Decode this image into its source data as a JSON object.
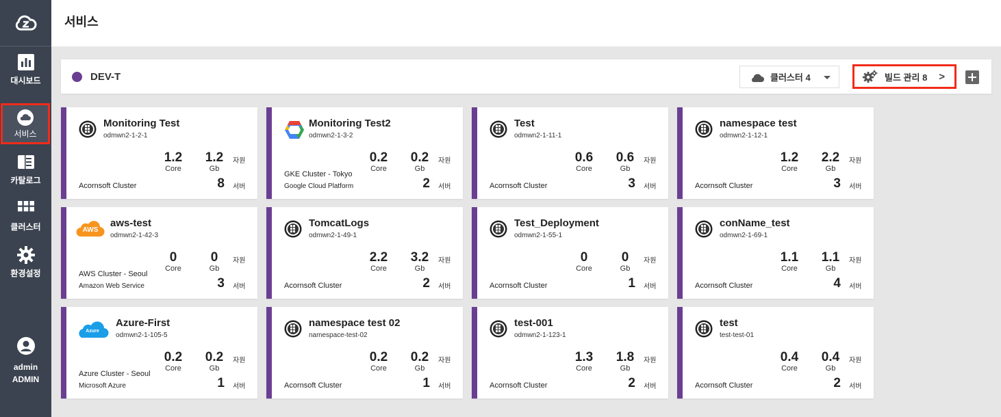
{
  "sidebar": {
    "items": [
      {
        "label": "대시보드",
        "icon": "dashboard-icon"
      },
      {
        "label": "서비스",
        "icon": "cloud-icon",
        "active": true
      },
      {
        "label": "카탈로그",
        "icon": "catalog-icon"
      },
      {
        "label": "클러스터",
        "icon": "grid-icon"
      },
      {
        "label": "환경설정",
        "icon": "gear-icon"
      }
    ],
    "user": {
      "name": "admin",
      "role": "ADMIN"
    }
  },
  "header": {
    "title": "서비스"
  },
  "toolbar": {
    "service_name": "DEV-T",
    "cluster_label": "클러스터 4",
    "build_label": "빌드 관리 8",
    "build_arrow": ">",
    "accent": "#6a3f92",
    "highlight": "#f12b1a"
  },
  "cards": [
    {
      "title": "Monitoring Test",
      "sub": "odmwn2-1-2-1",
      "core": "1.2",
      "core_unit": "Core",
      "gb": "1.2",
      "gb_unit": "Gb",
      "res_label": "자원",
      "servers": "8",
      "srv_label": "서버",
      "line1": "Acornsoft Cluster",
      "line2": "",
      "icon": "kubernetes-icon"
    },
    {
      "title": "Monitoring Test2",
      "sub": "odmwn2-1-3-2",
      "core": "0.2",
      "core_unit": "Core",
      "gb": "0.2",
      "gb_unit": "Gb",
      "res_label": "자원",
      "servers": "2",
      "srv_label": "서버",
      "line1": "GKE Cluster - Tokyo",
      "line2": "Google Cloud Platform",
      "icon": "gcp-icon"
    },
    {
      "title": "Test",
      "sub": "odmwn2-1-11-1",
      "core": "0.6",
      "core_unit": "Core",
      "gb": "0.6",
      "gb_unit": "Gb",
      "res_label": "자원",
      "servers": "3",
      "srv_label": "서버",
      "line1": "Acornsoft Cluster",
      "line2": "",
      "icon": "kubernetes-icon"
    },
    {
      "title": "namespace test",
      "sub": "odmwn2-1-12-1",
      "core": "1.2",
      "core_unit": "Core",
      "gb": "2.2",
      "gb_unit": "Gb",
      "res_label": "자원",
      "servers": "3",
      "srv_label": "서버",
      "line1": "Acornsoft Cluster",
      "line2": "",
      "icon": "kubernetes-icon"
    },
    {
      "title": "aws-test",
      "sub": "odmwn2-1-42-3",
      "core": "0",
      "core_unit": "Core",
      "gb": "0",
      "gb_unit": "Gb",
      "res_label": "자원",
      "servers": "3",
      "srv_label": "서버",
      "line1": "AWS Cluster - Seoul",
      "line2": "Amazon Web Service",
      "icon": "aws-icon",
      "icon_text": "AWS"
    },
    {
      "title": "TomcatLogs",
      "sub": "odmwn2-1-49-1",
      "core": "2.2",
      "core_unit": "Core",
      "gb": "3.2",
      "gb_unit": "Gb",
      "res_label": "자원",
      "servers": "2",
      "srv_label": "서버",
      "line1": "Acornsoft Cluster",
      "line2": "",
      "icon": "kubernetes-icon"
    },
    {
      "title": "Test_Deployment",
      "sub": "odmwn2-1-55-1",
      "core": "0",
      "core_unit": "Core",
      "gb": "0",
      "gb_unit": "Gb",
      "res_label": "자원",
      "servers": "1",
      "srv_label": "서버",
      "line1": "Acornsoft Cluster",
      "line2": "",
      "icon": "kubernetes-icon"
    },
    {
      "title": "conName_test",
      "sub": "odmwn2-1-69-1",
      "core": "1.1",
      "core_unit": "Core",
      "gb": "1.1",
      "gb_unit": "Gb",
      "res_label": "자원",
      "servers": "4",
      "srv_label": "서버",
      "line1": "Acornsoft Cluster",
      "line2": "",
      "icon": "kubernetes-icon"
    },
    {
      "title": "Azure-First",
      "sub": "odmwn2-1-105-5",
      "core": "0.2",
      "core_unit": "Core",
      "gb": "0.2",
      "gb_unit": "Gb",
      "res_label": "자원",
      "servers": "1",
      "srv_label": "서버",
      "line1": "Azure Cluster - Seoul",
      "line2": "Microsoft Azure",
      "icon": "azure-icon",
      "icon_text": "Azure"
    },
    {
      "title": "namespace test 02",
      "sub": "namespace-test-02",
      "core": "0.2",
      "core_unit": "Core",
      "gb": "0.2",
      "gb_unit": "Gb",
      "res_label": "자원",
      "servers": "1",
      "srv_label": "서버",
      "line1": "Acornsoft Cluster",
      "line2": "",
      "icon": "kubernetes-icon"
    },
    {
      "title": "test-001",
      "sub": "odmwn2-1-123-1",
      "core": "1.3",
      "core_unit": "Core",
      "gb": "1.8",
      "gb_unit": "Gb",
      "res_label": "자원",
      "servers": "2",
      "srv_label": "서버",
      "line1": "Acornsoft Cluster",
      "line2": "",
      "icon": "kubernetes-icon"
    },
    {
      "title": "test",
      "sub": "test-test-01",
      "core": "0.4",
      "core_unit": "Core",
      "gb": "0.4",
      "gb_unit": "Gb",
      "res_label": "자원",
      "servers": "2",
      "srv_label": "서버",
      "line1": "Acornsoft Cluster",
      "line2": "",
      "icon": "kubernetes-icon"
    }
  ]
}
